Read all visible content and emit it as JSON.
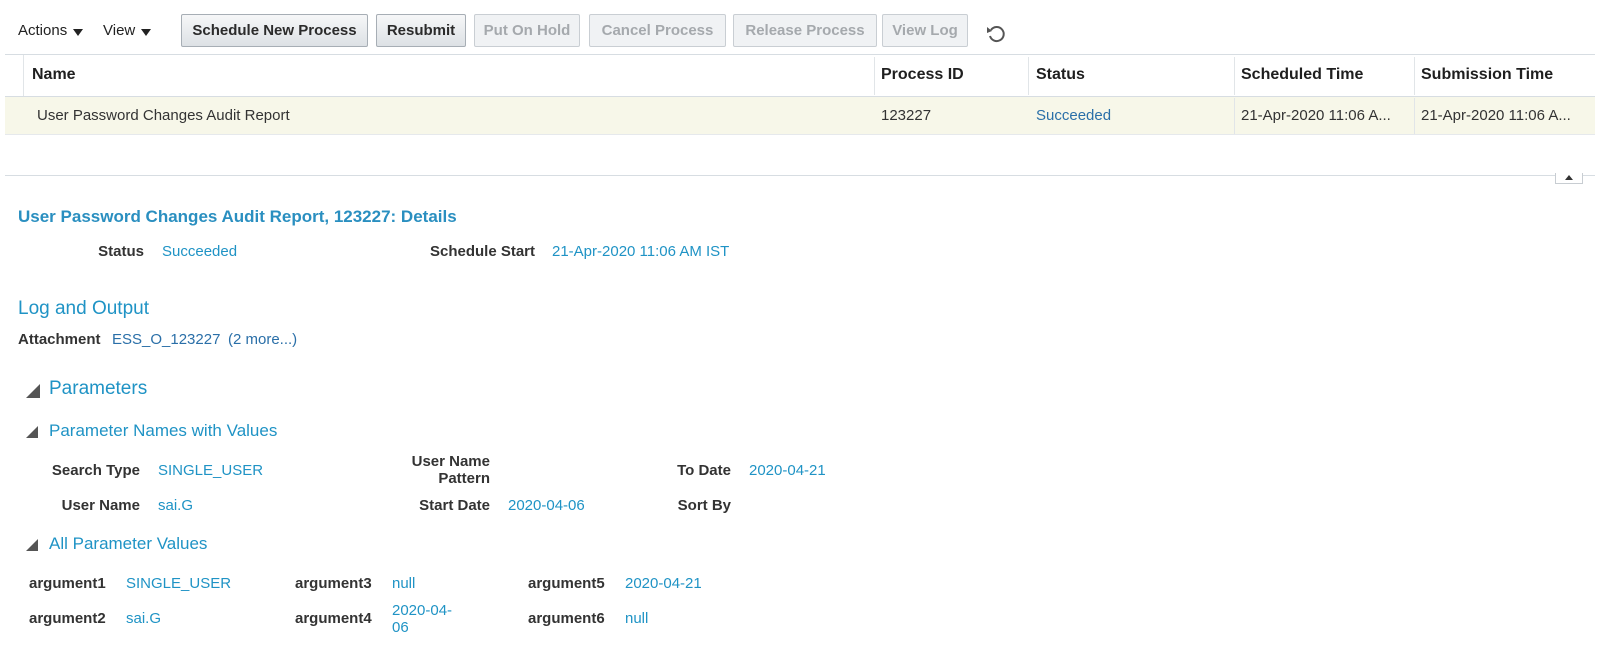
{
  "toolbar": {
    "actions_label": "Actions",
    "view_label": "View",
    "buttons": {
      "schedule": "Schedule New Process",
      "resubmit": "Resubmit",
      "hold": "Put On Hold",
      "cancel": "Cancel Process",
      "release": "Release Process",
      "log": "View Log"
    },
    "refresh_icon": "refresh-icon"
  },
  "table": {
    "headers": {
      "name": "Name",
      "process_id": "Process ID",
      "status": "Status",
      "scheduled_time": "Scheduled Time",
      "submission_time": "Submission Time"
    },
    "row": {
      "name": "User Password Changes Audit Report",
      "process_id": "123227",
      "status": "Succeeded",
      "scheduled_time": "21-Apr-2020 11:06 A...",
      "submission_time": "21-Apr-2020 11:06 A..."
    }
  },
  "details": {
    "title": "User Password Changes Audit Report, 123227: Details",
    "status_label": "Status",
    "status_value": "Succeeded",
    "schedule_start_label": "Schedule Start",
    "schedule_start_value": "21-Apr-2020 11:06 AM IST",
    "log_output_title": "Log and Output",
    "attachment_label": "Attachment",
    "attachment_value": "ESS_O_123227",
    "attachment_more": "(2 more...)",
    "parameters_title": "Parameters",
    "named_title": "Parameter Names with Values",
    "named": {
      "search_type_label": "Search Type",
      "search_type_value": "SINGLE_USER",
      "user_name_label": "User Name",
      "user_name_value": "sai.G",
      "pattern_label_1": "User Name",
      "pattern_label_2": "Pattern",
      "start_date_label": "Start Date",
      "start_date_value": "2020-04-06",
      "to_date_label": "To Date",
      "to_date_value": "2020-04-21",
      "sort_by_label": "Sort By"
    },
    "all_title": "All Parameter Values",
    "args": {
      "a1_label": "argument1",
      "a1_value": "SINGLE_USER",
      "a2_label": "argument2",
      "a2_value": "sai.G",
      "a3_label": "argument3",
      "a3_value": "null",
      "a4_label": "argument4",
      "a4_value_1": "2020-04-",
      "a4_value_2": "06",
      "a5_label": "argument5",
      "a5_value": "2020-04-21",
      "a6_label": "argument6",
      "a6_value": "null"
    }
  },
  "colors": {
    "link_blue": "#1f93c5",
    "row_highlight": "#f7f7e9"
  }
}
